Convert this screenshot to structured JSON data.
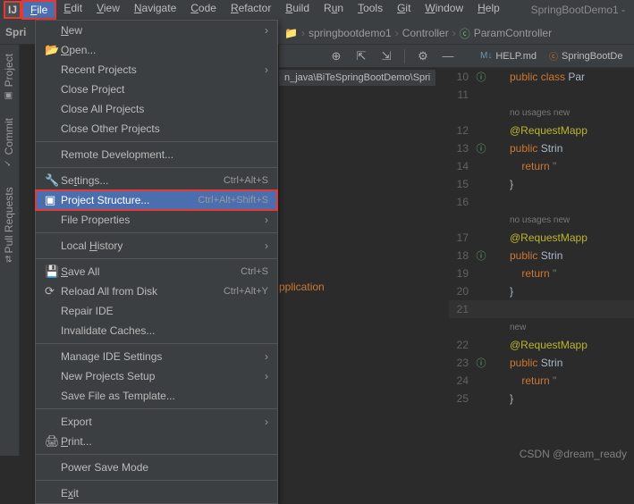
{
  "app": {
    "title": "SpringBootDemo1 -"
  },
  "menubar": {
    "items": [
      {
        "label": "File",
        "key": "F",
        "active": true
      },
      {
        "label": "Edit",
        "key": "E"
      },
      {
        "label": "View",
        "key": "V"
      },
      {
        "label": "Navigate",
        "key": "N"
      },
      {
        "label": "Code",
        "key": "C"
      },
      {
        "label": "Refactor",
        "key": "R"
      },
      {
        "label": "Build",
        "key": "B"
      },
      {
        "label": "Run",
        "key": "u"
      },
      {
        "label": "Tools",
        "key": "T"
      },
      {
        "label": "Git",
        "key": "G"
      },
      {
        "label": "Window",
        "key": "W"
      },
      {
        "label": "Help",
        "key": "H"
      }
    ]
  },
  "breadcrumb": {
    "project_abbrev": "Spri",
    "parts": [
      {
        "text": "springbootdemo1",
        "icon": "folder"
      },
      {
        "text": "Controller",
        "icon": "folder"
      },
      {
        "text": "ParamController",
        "icon": "class",
        "green": true
      }
    ]
  },
  "side_tabs": [
    {
      "label": "Project"
    },
    {
      "label": "Commit"
    },
    {
      "label": "Pull Requests"
    }
  ],
  "file_menu": {
    "items": [
      {
        "label": "New",
        "key": "N",
        "arrow": true
      },
      {
        "label": "Open...",
        "key": "O",
        "icon": "open"
      },
      {
        "label": "Recent Projects",
        "arrow": true
      },
      {
        "label": "Close Project"
      },
      {
        "label": "Close All Projects"
      },
      {
        "label": "Close Other Projects"
      },
      {
        "sep": true
      },
      {
        "label": "Remote Development..."
      },
      {
        "sep": true
      },
      {
        "label": "Settings...",
        "key": "t",
        "icon": "wrench",
        "shortcut": "Ctrl+Alt+S"
      },
      {
        "label": "Project Structure...",
        "icon": "structure",
        "shortcut": "Ctrl+Alt+Shift+S",
        "highlighted": true
      },
      {
        "label": "File Properties",
        "arrow": true
      },
      {
        "sep": true
      },
      {
        "label": "Local History",
        "key": "H",
        "arrow": true
      },
      {
        "sep": true
      },
      {
        "label": "Save All",
        "key": "S",
        "icon": "save",
        "shortcut": "Ctrl+S"
      },
      {
        "label": "Reload All from Disk",
        "icon": "reload",
        "shortcut": "Ctrl+Alt+Y"
      },
      {
        "label": "Repair IDE"
      },
      {
        "label": "Invalidate Caches..."
      },
      {
        "sep": true
      },
      {
        "label": "Manage IDE Settings",
        "arrow": true
      },
      {
        "label": "New Projects Setup",
        "arrow": true
      },
      {
        "label": "Save File as Template..."
      },
      {
        "sep": true
      },
      {
        "label": "Export",
        "arrow": true
      },
      {
        "label": "Print...",
        "key": "P",
        "icon": "print"
      },
      {
        "sep": true
      },
      {
        "label": "Power Save Mode"
      },
      {
        "sep": true
      },
      {
        "label": "Exit",
        "key": "x"
      }
    ]
  },
  "editor_tabs": [
    {
      "label": "HELP.md",
      "icon": "md",
      "color": "blue"
    },
    {
      "label": "SpringBootDe",
      "icon": "class",
      "color": "orange",
      "partial": true
    }
  ],
  "path_fragment": "n_java\\BiTeSpringBootDemo\\Spri",
  "app_text": "pplication",
  "code": {
    "lines": [
      {
        "n": "10",
        "icon": "impl",
        "tokens": [
          {
            "t": "public ",
            "c": "kw"
          },
          {
            "t": "class ",
            "c": "kw"
          },
          {
            "t": "Par",
            "c": "cls"
          }
        ]
      },
      {
        "n": "11",
        "tokens": []
      },
      {
        "n": "",
        "hint": "no usages   new"
      },
      {
        "n": "12",
        "tokens": [
          {
            "t": "@RequestMapp",
            "c": "ann"
          }
        ]
      },
      {
        "n": "13",
        "icon": "impl",
        "tokens": [
          {
            "t": "public ",
            "c": "kw"
          },
          {
            "t": "Strin",
            "c": "cls"
          }
        ]
      },
      {
        "n": "14",
        "tokens": [
          {
            "t": "    return ",
            "c": "kw"
          },
          {
            "t": "\"",
            "c": "str"
          }
        ]
      },
      {
        "n": "15",
        "tokens": [
          {
            "t": "}",
            "c": "cls"
          }
        ]
      },
      {
        "n": "16",
        "tokens": []
      },
      {
        "n": "",
        "hint": "no usages   new"
      },
      {
        "n": "17",
        "tokens": [
          {
            "t": "@RequestMapp",
            "c": "ann"
          }
        ]
      },
      {
        "n": "18",
        "icon": "impl",
        "tokens": [
          {
            "t": "public ",
            "c": "kw"
          },
          {
            "t": "Strin",
            "c": "cls"
          }
        ]
      },
      {
        "n": "19",
        "tokens": [
          {
            "t": "    return ",
            "c": "kw"
          },
          {
            "t": "\"",
            "c": "str"
          }
        ]
      },
      {
        "n": "20",
        "tokens": [
          {
            "t": "}",
            "c": "cls"
          }
        ]
      },
      {
        "n": "21",
        "bg": true,
        "tokens": []
      },
      {
        "n": "",
        "hint": "new"
      },
      {
        "n": "22",
        "tokens": [
          {
            "t": "@RequestMapp",
            "c": "ann"
          }
        ]
      },
      {
        "n": "23",
        "icon": "impl",
        "tokens": [
          {
            "t": "public ",
            "c": "kw"
          },
          {
            "t": "Strin",
            "c": "cls"
          }
        ]
      },
      {
        "n": "24",
        "tokens": [
          {
            "t": "    return ",
            "c": "kw"
          },
          {
            "t": "\"",
            "c": "str"
          }
        ]
      },
      {
        "n": "25",
        "tokens": [
          {
            "t": "}",
            "c": "cls"
          }
        ]
      }
    ]
  },
  "watermark": "CSDN @dream_ready"
}
